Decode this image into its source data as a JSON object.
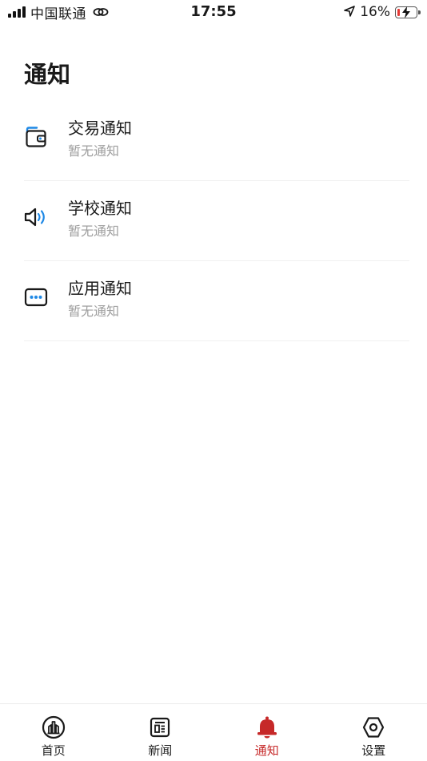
{
  "status_bar": {
    "carrier": "中国联通",
    "time": "17:55",
    "battery_percent": "16%",
    "battery_level": 0.16,
    "icons": [
      "signal-icon",
      "link-icon",
      "location-arrow-icon",
      "battery-charging-icon"
    ]
  },
  "page": {
    "title": "通知"
  },
  "notices": [
    {
      "title": "交易通知",
      "subtitle": "暂无通知",
      "icon": "wallet-icon"
    },
    {
      "title": "学校通知",
      "subtitle": "暂无通知",
      "icon": "speaker-icon"
    },
    {
      "title": "应用通知",
      "subtitle": "暂无通知",
      "icon": "message-dots-icon"
    }
  ],
  "tab_bar": {
    "tabs": [
      {
        "label": "首页",
        "icon": "home-building-icon",
        "active": false
      },
      {
        "label": "新闻",
        "icon": "news-icon",
        "active": false
      },
      {
        "label": "通知",
        "icon": "bell-icon",
        "active": true
      },
      {
        "label": "设置",
        "icon": "settings-hex-icon",
        "active": false
      }
    ]
  },
  "colors": {
    "accent": "#c62828",
    "icon_blue": "#1e88e5",
    "muted_text": "#9e9e9e",
    "battery_low": "#e53935"
  }
}
